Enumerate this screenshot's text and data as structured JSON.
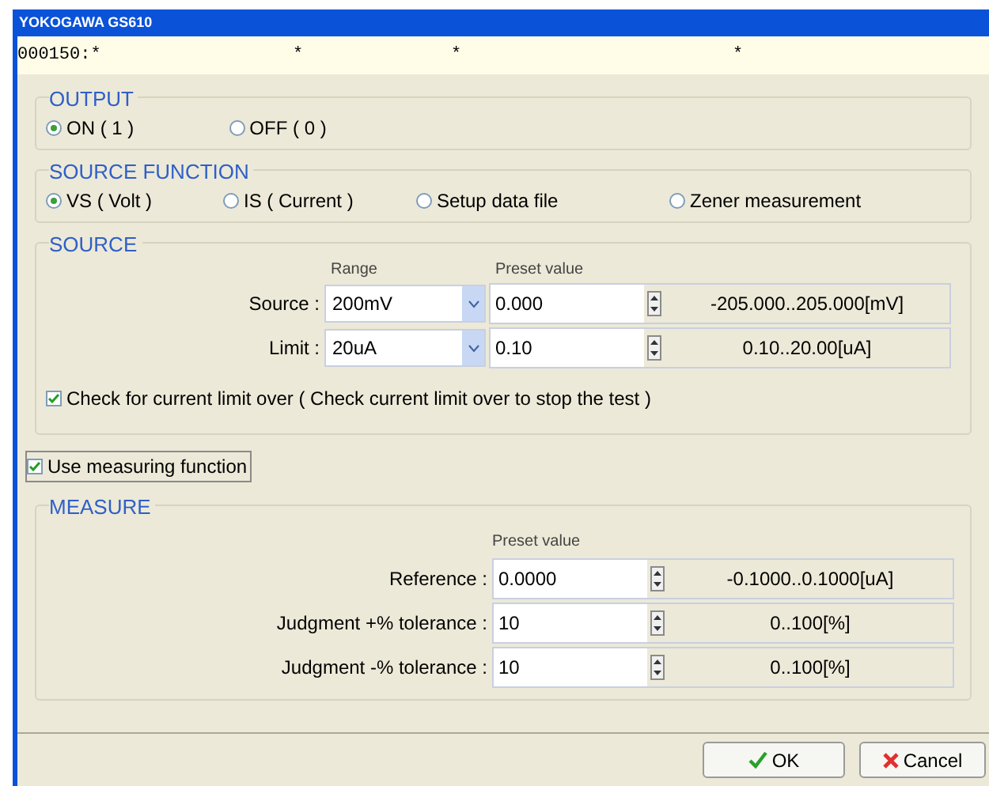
{
  "window": {
    "title": "YOKOGAWA GS610"
  },
  "status_line": [
    "000150:*",
    "*",
    "*",
    "*"
  ],
  "output": {
    "title": "OUTPUT",
    "options": [
      {
        "label": "ON ( 1 )",
        "selected": true
      },
      {
        "label": "OFF ( 0 )",
        "selected": false
      }
    ]
  },
  "source_function": {
    "title": "SOURCE FUNCTION",
    "options": [
      {
        "label": "VS ( Volt )",
        "selected": true
      },
      {
        "label": "IS ( Current )",
        "selected": false
      },
      {
        "label": "Setup data file",
        "selected": false
      },
      {
        "label": "Zener measurement",
        "selected": false
      }
    ]
  },
  "source": {
    "title": "SOURCE",
    "range_header": "Range",
    "preset_header": "Preset value",
    "rows": [
      {
        "label": "Source :",
        "range": "200mV",
        "value": "0.000",
        "limits": "-205.000..205.000[mV]"
      },
      {
        "label": "Limit :",
        "range": "20uA",
        "value": "0.10",
        "limits": "0.10..20.00[uA]"
      }
    ],
    "check": {
      "label": "Check for current limit over ( Check current limit over to stop the test )",
      "checked": true
    }
  },
  "use_measuring": {
    "label": "Use measuring function",
    "checked": true
  },
  "measure": {
    "title": "MEASURE",
    "preset_header": "Preset value",
    "rows": [
      {
        "label": "Reference :",
        "value": "0.0000",
        "limits": "-0.1000..0.1000[uA]"
      },
      {
        "label": "Judgment +% tolerance :",
        "value": "10",
        "limits": "0..100[%]"
      },
      {
        "label": "Judgment -% tolerance :",
        "value": "10",
        "limits": "0..100[%]"
      }
    ]
  },
  "buttons": [
    {
      "kind": "ok",
      "label": "OK"
    },
    {
      "kind": "cancel",
      "label": "Cancel"
    }
  ]
}
